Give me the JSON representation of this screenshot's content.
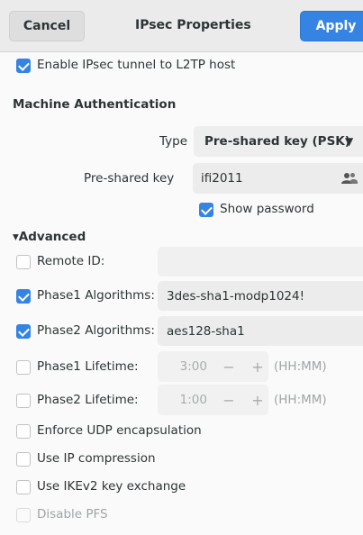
{
  "header": {
    "cancel_label": "Cancel",
    "title": "IPsec Properties",
    "apply_label": "Apply"
  },
  "enable_ipsec": {
    "label": "Enable IPsec tunnel to L2TP host",
    "checked": true
  },
  "machine_auth": {
    "heading": "Machine Authentication",
    "type_label": "Type",
    "type_value": "Pre-shared key (PSK)",
    "psk_label": "Pre-shared key",
    "psk_value": "ifi2011",
    "show_password_label": "Show password",
    "show_password_checked": true
  },
  "advanced": {
    "heading": "Advanced",
    "remote_id": {
      "label": "Remote ID:",
      "checked": false,
      "value": ""
    },
    "phase1_algorithms": {
      "label": "Phase1 Algorithms:",
      "checked": true,
      "value": "3des-sha1-modp1024!"
    },
    "phase2_algorithms": {
      "label": "Phase2 Algorithms:",
      "checked": true,
      "value": "aes128-sha1"
    },
    "phase1_lifetime": {
      "label": "Phase1 Lifetime:",
      "checked": false,
      "value": "3:00",
      "unit": "(HH:MM)"
    },
    "phase2_lifetime": {
      "label": "Phase2 Lifetime:",
      "checked": false,
      "value": "1:00",
      "unit": "(HH:MM)"
    },
    "enforce_udp": {
      "label": "Enforce UDP encapsulation",
      "checked": false
    },
    "ip_compression": {
      "label": "Use IP compression",
      "checked": false
    },
    "ikev2": {
      "label": "Use IKEv2 key exchange",
      "checked": false
    },
    "disable_pfs": {
      "label": "Disable PFS",
      "checked": false,
      "disabled": true
    }
  },
  "icons": {
    "spin_minus": "−",
    "spin_plus": "+",
    "expander": "▾",
    "dropdown": "▼"
  },
  "colors": {
    "accent": "#3584e4",
    "header_bg": "#ebebeb",
    "text": "#2e3436"
  }
}
